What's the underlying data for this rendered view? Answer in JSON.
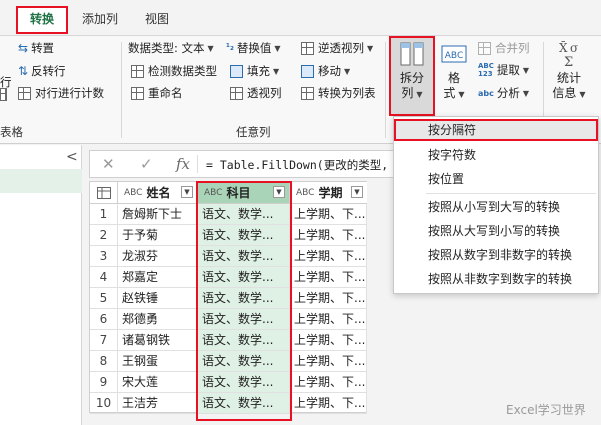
{
  "tabs": {
    "transform": "转换",
    "add_column": "添加列",
    "view": "视图"
  },
  "ribbon": {
    "table_group": {
      "label": "表格",
      "transpose": "转置",
      "reverse_rows": "反转行",
      "count_rows": "对行进行计数",
      "partial": "行"
    },
    "any_column": {
      "label": "任意列",
      "data_type": "数据类型: 文本",
      "detect_type": "检测数据类型",
      "rename": "重命名",
      "replace_values": "替换值",
      "fill": "填充",
      "pivot_column": "透视列",
      "unpivot_columns": "逆透视列",
      "move": "移动",
      "convert_to_list": "转换为列表"
    },
    "text_column": {
      "split_column_l1": "拆分",
      "split_column_l2": "列",
      "format_l1": "格",
      "format_l2": "式",
      "merge_columns": "合并列",
      "extract": "提取",
      "parse": "分析",
      "abc_icon_text": "ABC",
      "abc_123_text": "123"
    },
    "statistics_l1": "统计",
    "statistics_l2": "信息"
  },
  "formula_bar": {
    "text": "= Table.FillDown(更改的类型,"
  },
  "grid": {
    "type_label": "ABC",
    "columns": [
      "姓名",
      "科目",
      "学期"
    ],
    "rows": [
      [
        "1",
        "詹姆斯下士",
        "语文、数学...",
        "上学期、下..."
      ],
      [
        "2",
        "于予菊",
        "语文、数学...",
        "上学期、下..."
      ],
      [
        "3",
        "龙淑芬",
        "语文、数学...",
        "上学期、下..."
      ],
      [
        "4",
        "郑嘉定",
        "语文、数学...",
        "上学期、下..."
      ],
      [
        "5",
        "赵铁锤",
        "语文、数学...",
        "上学期、下..."
      ],
      [
        "6",
        "郑德勇",
        "语文、数学...",
        "上学期、下..."
      ],
      [
        "7",
        "诸葛钢铁",
        "语文、数学...",
        "上学期、下..."
      ],
      [
        "8",
        "王钢蛋",
        "语文、数学...",
        "上学期、下..."
      ],
      [
        "9",
        "宋大莲",
        "语文、数学...",
        "上学期、下..."
      ],
      [
        "10",
        "王洁芳",
        "语文、数学...",
        "上学期、下..."
      ]
    ]
  },
  "split_menu": {
    "items": [
      "按分隔符",
      "按字符数",
      "按位置",
      "按照从小写到大写的转换",
      "按照从大写到小写的转换",
      "按照从数字到非数字的转换",
      "按照从非数字到数字的转换"
    ]
  },
  "watermark": "Excel学习世界",
  "colors": {
    "highlight_red": "#e81123",
    "accent_green": "#217346",
    "selected_column": "#dff0e5"
  }
}
